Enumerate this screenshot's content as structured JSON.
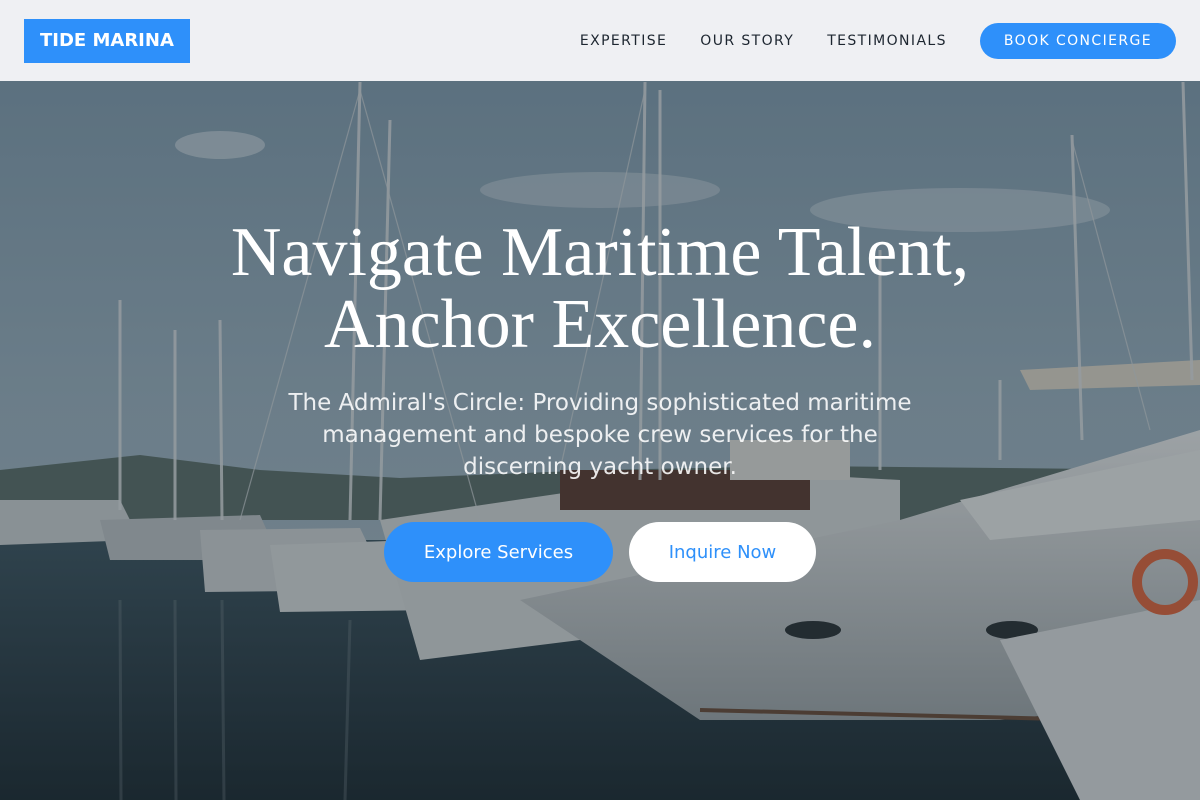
{
  "header": {
    "logo": "TIDE MARINA",
    "nav": [
      "EXPERTISE",
      "OUR STORY",
      "TESTIMONIALS"
    ],
    "cta": "BOOK CONCIERGE"
  },
  "hero": {
    "title_line1": "Navigate Maritime Talent,",
    "title_line2": "Anchor Excellence.",
    "subtitle": "The Admiral's Circle: Providing sophisticated maritime management and bespoke crew services for the discerning yacht owner.",
    "primary_button": "Explore Services",
    "secondary_button": "Inquire Now",
    "background_image": "marina-yachts-photo"
  },
  "colors": {
    "accent": "#2e90fa",
    "header_bg": "#f4f5f7",
    "nav_text": "#1d2630"
  }
}
